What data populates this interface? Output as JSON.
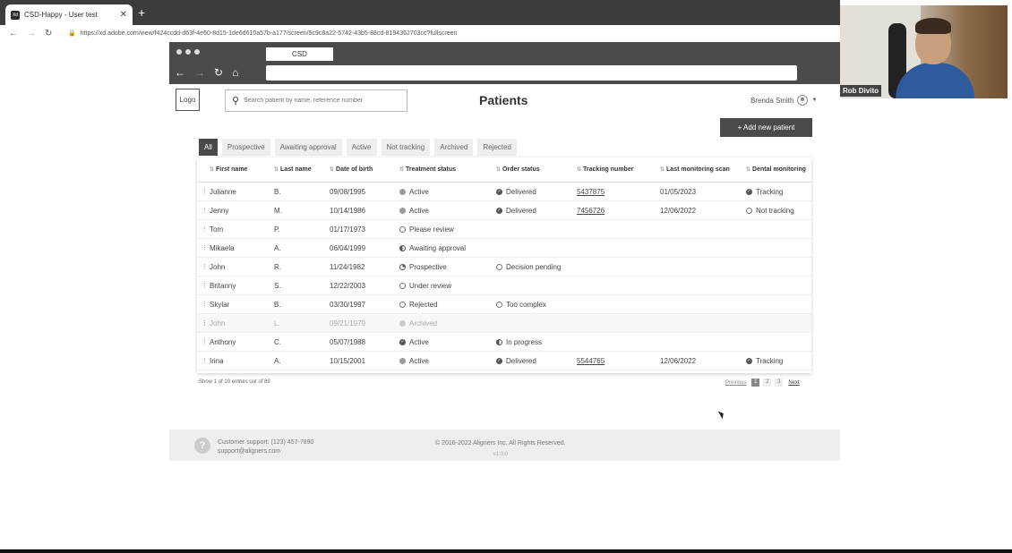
{
  "browser": {
    "tab_title": "CSD-Happy - User test",
    "favicon": "Xd",
    "url": "https://xd.adobe.com/view/f424ccdd-d63f-4e60-8d15-1de6d610a57b-a177/screen/5c9c8a22-5742-43b5-88cd-8194362703cc?fullscreen"
  },
  "webcam": {
    "name": "Rob Divito"
  },
  "inner_browser": {
    "tab_title": "CSD"
  },
  "header": {
    "logo": "Logo",
    "search_placeholder": "Search patient by name, reference number",
    "title": "Patients",
    "user_name": "Brenda Smith",
    "add_button": "+ Add new patient"
  },
  "filters": [
    "All",
    "Prospective",
    "Awaiting approval",
    "Active",
    "Not tracking",
    "Archived",
    "Rejected"
  ],
  "table": {
    "columns": [
      "First name",
      "Last name",
      "Date of birth",
      "Treatment status",
      "Order status",
      "Tracking number",
      "Last monitoring scan",
      "Dental monitoring"
    ],
    "rows": [
      {
        "first": "Julianne",
        "last": "B.",
        "dob": "09/08/1995",
        "treatment": "Active",
        "t_icon": "dot",
        "order": "Delivered",
        "o_icon": "check",
        "tracking": "5437875",
        "scan": "01/05/2023",
        "monitoring": "Tracking",
        "m_icon": "check"
      },
      {
        "first": "Jenny",
        "last": "M.",
        "dob": "10/14/1986",
        "treatment": "Active",
        "t_icon": "dot",
        "order": "Delivered",
        "o_icon": "check",
        "tracking": "7456726",
        "scan": "12/06/2022",
        "monitoring": "Not tracking",
        "m_icon": "ring"
      },
      {
        "first": "Tom",
        "last": "P.",
        "dob": "01/17/1973",
        "treatment": "Please review",
        "t_icon": "ring",
        "order": "",
        "o_icon": "",
        "tracking": "",
        "scan": "",
        "monitoring": "",
        "m_icon": ""
      },
      {
        "first": "Mikaela",
        "last": "A.",
        "dob": "06/04/1999",
        "treatment": "Awaiting approval",
        "t_icon": "half",
        "order": "",
        "o_icon": "",
        "tracking": "",
        "scan": "",
        "monitoring": "",
        "m_icon": ""
      },
      {
        "first": "John",
        "last": "R.",
        "dob": "11/24/1982",
        "treatment": "Prospective",
        "t_icon": "quarter",
        "order": "Decision pending",
        "o_icon": "ring",
        "tracking": "",
        "scan": "",
        "monitoring": "",
        "m_icon": ""
      },
      {
        "first": "Britanny",
        "last": "S.",
        "dob": "12/22/2003",
        "treatment": "Under review",
        "t_icon": "ring",
        "order": "",
        "o_icon": "",
        "tracking": "",
        "scan": "",
        "monitoring": "",
        "m_icon": ""
      },
      {
        "first": "Skylar",
        "last": "B.",
        "dob": "03/30/1997",
        "treatment": "Rejected",
        "t_icon": "ring",
        "order": "Too complex",
        "o_icon": "ring",
        "tracking": "",
        "scan": "",
        "monitoring": "",
        "m_icon": ""
      },
      {
        "first": "John",
        "last": "L.",
        "dob": "09/21/1979",
        "treatment": "Archived",
        "t_icon": "dot",
        "order": "",
        "o_icon": "",
        "tracking": "",
        "scan": "",
        "monitoring": "",
        "m_icon": "",
        "dim": true
      },
      {
        "first": "Anthony",
        "last": "C.",
        "dob": "05/07/1988",
        "treatment": "Active",
        "t_icon": "check",
        "order": "In progress",
        "o_icon": "half",
        "tracking": "",
        "scan": "",
        "monitoring": "",
        "m_icon": ""
      },
      {
        "first": "Irina",
        "last": "A.",
        "dob": "10/15/2001",
        "treatment": "Active",
        "t_icon": "dot",
        "order": "Delivered",
        "o_icon": "check",
        "tracking": "5544765",
        "scan": "12/06/2022",
        "monitoring": "Tracking",
        "m_icon": "check"
      }
    ]
  },
  "pagination": {
    "info": "Show 1 of 10 entries out of 89",
    "previous": "Previous",
    "pages": [
      "1",
      "2",
      "3"
    ],
    "next": "Next"
  },
  "footer": {
    "support_phone": "Customer support: (123) 457-7890",
    "support_email": "support@aligners.com",
    "copyright": "© 2016-2022 Aligners Inc. All Rights Reserved.",
    "version": "v1.0.0"
  }
}
